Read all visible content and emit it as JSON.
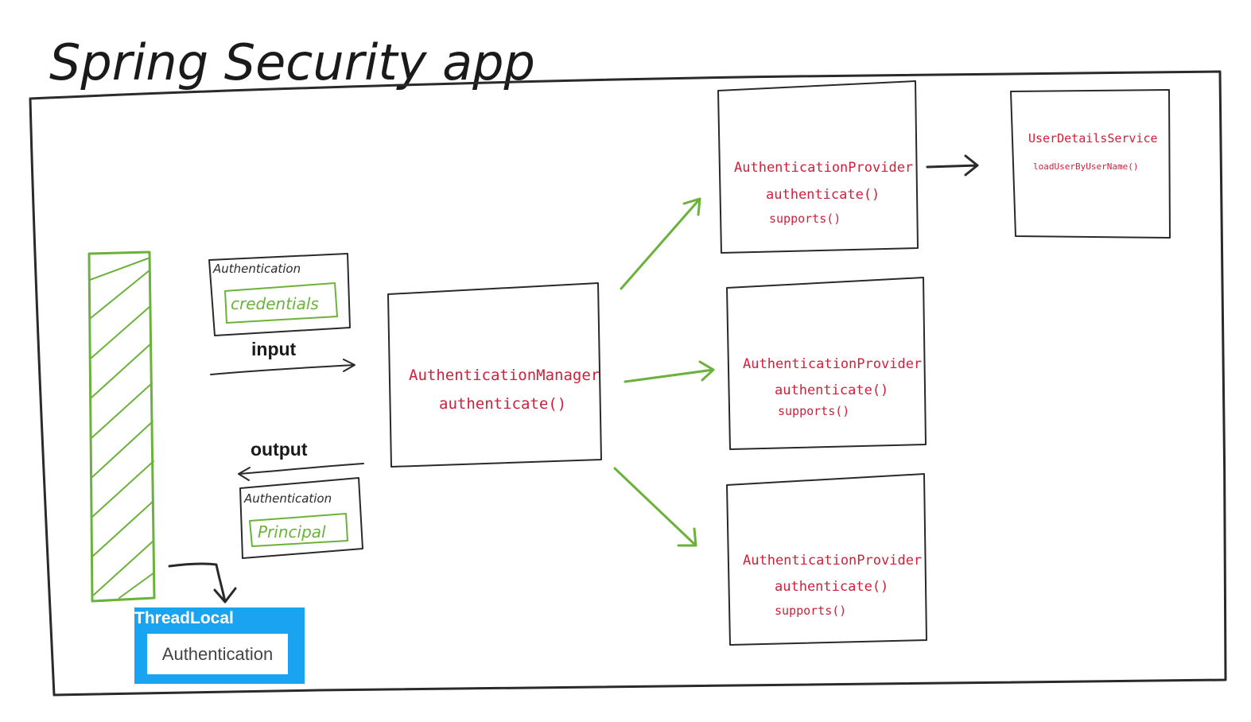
{
  "title": "Spring Security app",
  "colors": {
    "ink": "#2a2a2a",
    "code_red": "#d0203a",
    "green": "#6ab23a",
    "threadlocal_blue": "#1aa3f0"
  },
  "input": {
    "label": "input",
    "box_title": "Authentication",
    "box_inner": "credentials"
  },
  "output": {
    "label": "output",
    "box_title": "Authentication",
    "box_inner": "Principal"
  },
  "manager": {
    "name": "AuthenticationManager",
    "method": "authenticate()"
  },
  "providers": [
    {
      "name": "AuthenticationProvider",
      "method1": "authenticate()",
      "method2": "supports()"
    },
    {
      "name": "AuthenticationProvider",
      "method1": "authenticate()",
      "method2": "supports()"
    },
    {
      "name": "AuthenticationProvider",
      "method1": "authenticate()",
      "method2": "supports()"
    }
  ],
  "user_details": {
    "name": "UserDetailsService",
    "method": "loadUserByUserName()"
  },
  "threadlocal": {
    "title": "ThreadLocal",
    "inner": "Authentication"
  }
}
